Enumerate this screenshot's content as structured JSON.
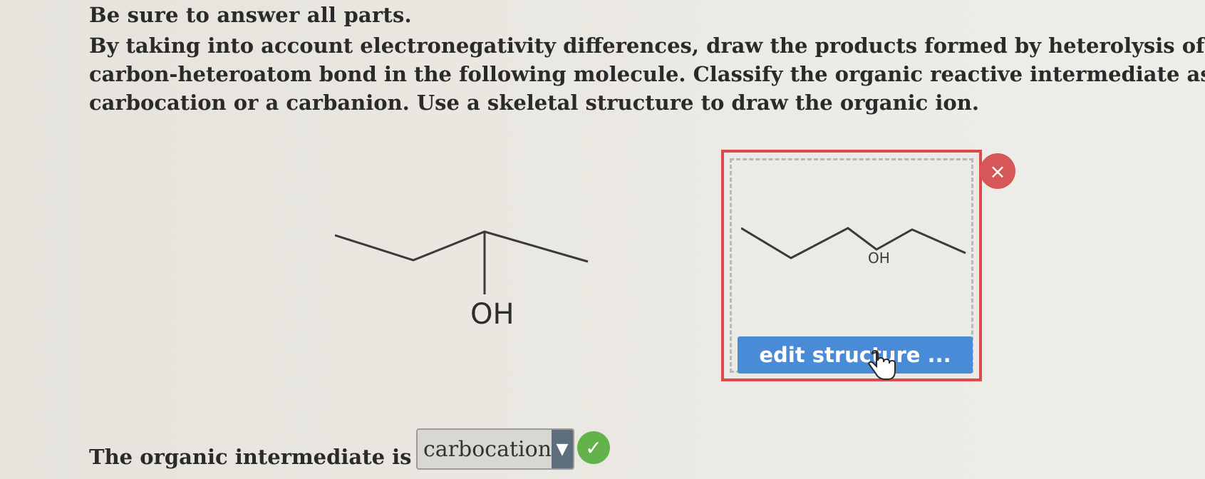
{
  "instructions": "Be sure to answer all parts.",
  "question_lines": [
    "By taking into account electronegativity differences, draw the products formed by heterolysis of the",
    "carbon-heteroatom bond in the following molecule. Classify the organic reactive intermediate as a",
    "carbocation or a carbanion. Use a skeletal structure to draw the organic ion."
  ],
  "molecule": {
    "substituent_label": "OH"
  },
  "answer_box": {
    "drawn_label": "OH",
    "edit_button_label": "edit structure ...",
    "close_icon": "×"
  },
  "classification": {
    "label": "The organic intermediate is a",
    "selected": "carbocation",
    "dropdown_icon": "▼",
    "status_icon": "✓"
  },
  "colors": {
    "accent_blue": "#4a8bd7",
    "error_red": "#dd4a4a",
    "success_green": "#63b34a"
  }
}
